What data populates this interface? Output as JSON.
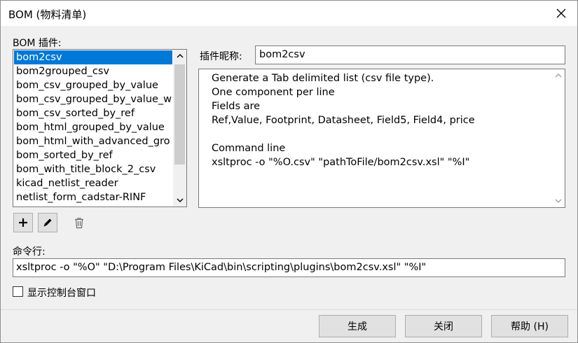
{
  "window": {
    "title": "BOM (物料清单)"
  },
  "plugins": {
    "label": "BOM 插件:",
    "items": [
      "bom2csv",
      "bom2grouped_csv",
      "bom_csv_grouped_by_value",
      "bom_csv_grouped_by_value_w",
      "bom_csv_sorted_by_ref",
      "bom_html_grouped_by_value",
      "bom_html_with_advanced_gro",
      "bom_sorted_by_ref",
      "bom_with_title_block_2_csv",
      "kicad_netlist_reader",
      "netlist_form_cadstar-RINF"
    ],
    "selected_index": 0
  },
  "nickname": {
    "label": "插件昵称:",
    "value": "bom2csv"
  },
  "description": {
    "lines": [
      "Generate a Tab delimited list (csv file type).",
      "One component per line",
      "Fields are",
      "Ref,Value, Footprint, Datasheet, Field5, Field4, price",
      "",
      "Command line",
      "xsltproc -o \"%O.csv\" \"pathToFile/bom2csv.xsl\" \"%I\""
    ]
  },
  "toolbar": {
    "icons": [
      "plus-icon",
      "pencil-icon",
      "trash-icon"
    ]
  },
  "command": {
    "label": "命令行:",
    "value": "xsltproc -o \"%O\" \"D:\\Program Files\\KiCad\\bin\\scripting\\plugins\\bom2csv.xsl\" \"%I\""
  },
  "console": {
    "label": "显示控制台窗口",
    "checked": false
  },
  "buttons": {
    "generate": "生成",
    "close": "关闭",
    "help": "帮助 (H)"
  },
  "colors": {
    "selection": "#0078d7",
    "background": "#f0f0f0"
  }
}
